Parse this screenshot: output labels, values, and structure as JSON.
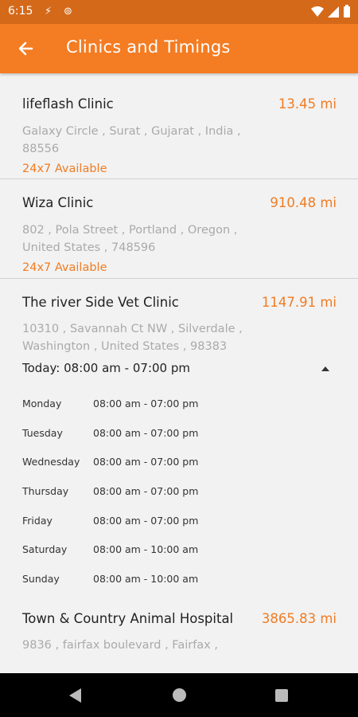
{
  "status_bar": {
    "time": "6:15"
  },
  "header": {
    "title": "Clinics and Timings"
  },
  "clinics": [
    {
      "name": "lifeflash Clinic",
      "distance": "13.45 mi",
      "address": "Galaxy Circle , Surat , Gujarat , India , 88556",
      "availability": "24x7 Available"
    },
    {
      "name": "Wiza Clinic",
      "distance": "910.48 mi",
      "address": "802 , Pola Street , Portland , Oregon , United States , 748596",
      "availability": "24x7 Available"
    },
    {
      "name": "The river Side Vet Clinic",
      "distance": "1147.91 mi",
      "address": "10310 , Savannah Ct NW , Silverdale , Washington , United States , 98383",
      "today": "Today: 08:00 am - 07:00 pm",
      "schedule": [
        {
          "day": "Monday",
          "hours": "08:00 am - 07:00 pm"
        },
        {
          "day": "Tuesday",
          "hours": "08:00 am - 07:00 pm"
        },
        {
          "day": "Wednesday",
          "hours": "08:00 am - 07:00 pm"
        },
        {
          "day": "Thursday",
          "hours": "08:00 am - 07:00 pm"
        },
        {
          "day": "Friday",
          "hours": "08:00 am - 07:00 pm"
        },
        {
          "day": "Saturday",
          "hours": "08:00 am - 10:00 am"
        },
        {
          "day": "Sunday",
          "hours": "08:00 am - 10:00 am"
        }
      ]
    },
    {
      "name": "Town & Country Animal Hospital",
      "distance": "3865.83 mi",
      "address": "9836 , fairfax boulevard , Fairfax ,"
    }
  ],
  "colors": {
    "accent": "#f47c22",
    "status_bar": "#d4691a"
  }
}
